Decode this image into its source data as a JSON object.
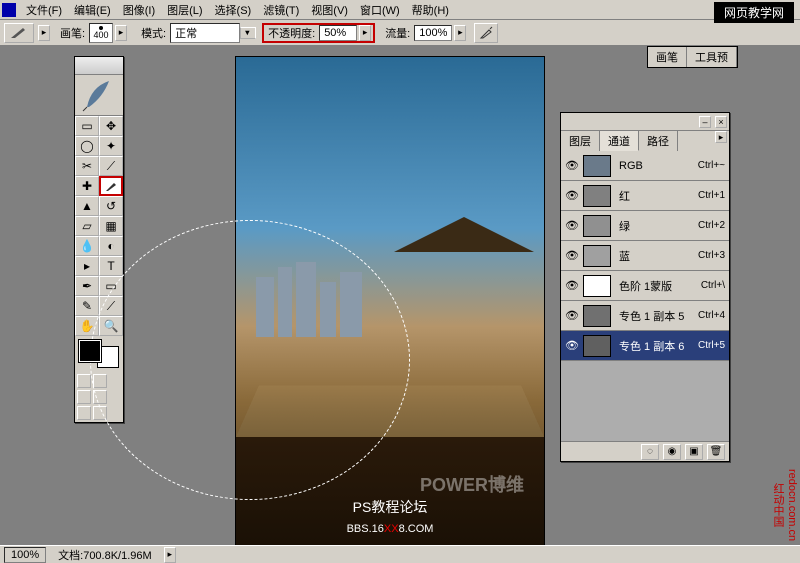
{
  "menu": {
    "items": [
      "文件(F)",
      "编辑(E)",
      "图像(I)",
      "图层(L)",
      "选择(S)",
      "滤镜(T)",
      "视图(V)",
      "窗口(W)",
      "帮助(H)"
    ]
  },
  "topbar_brand": "网页教学网",
  "options": {
    "brush_label": "画笔:",
    "brush_size": "400",
    "mode_label": "模式:",
    "mode_value": "正常",
    "opacity_label": "不透明度:",
    "opacity_value": "50%",
    "flow_label": "流量:",
    "flow_value": "100%"
  },
  "panel": {
    "tabs": [
      "图层",
      "通道",
      "路径"
    ],
    "active_tab": 1,
    "channels": [
      {
        "name": "RGB",
        "key": "Ctrl+~",
        "thumb": "#6a7a8a"
      },
      {
        "name": "红",
        "key": "Ctrl+1",
        "thumb": "#808080"
      },
      {
        "name": "绿",
        "key": "Ctrl+2",
        "thumb": "#909090"
      },
      {
        "name": "蓝",
        "key": "Ctrl+3",
        "thumb": "#a0a0a0"
      },
      {
        "name": "色阶 1蒙版",
        "key": "Ctrl+\\",
        "thumb": "#ffffff"
      },
      {
        "name": "专色 1 副本 5",
        "key": "Ctrl+4",
        "thumb": "#707070"
      },
      {
        "name": "专色 1 副本 6",
        "key": "Ctrl+5",
        "thumb": "#606060"
      }
    ],
    "selected": 6
  },
  "right_tabs": [
    "画笔",
    "工具预"
  ],
  "status": {
    "zoom": "100%",
    "doc": "文档:700.8K/1.96M"
  },
  "canvas": {
    "wm1": "POWER博维",
    "wm2": "PS教程论坛",
    "wm3_a": "BBS.16",
    "wm3_x": "XX",
    "wm3_b": "8.COM"
  },
  "side_wm": {
    "url": "redocn.com.cn",
    "cn": "红动中国"
  }
}
